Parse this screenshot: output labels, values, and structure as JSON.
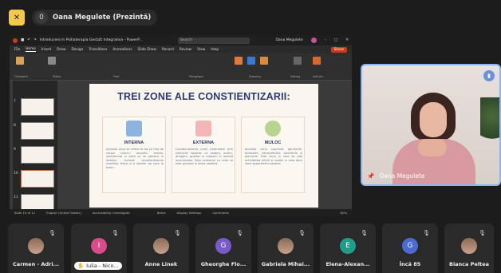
{
  "topbar": {
    "count": "0",
    "presenter_label": "Oana Megulete (Prezintă)",
    "accent": "#f2c94c"
  },
  "ppt": {
    "title_text": "Introducere în Psihoterapia Gestalt Integrativa - PowerP...",
    "search_placeholder": "Search",
    "user_name": "Oana Megulete",
    "menu": [
      "File",
      "Home",
      "Insert",
      "Draw",
      "Design",
      "Transitions",
      "Animations",
      "Slide Show",
      "Record",
      "Review",
      "View",
      "Help"
    ],
    "share_label": "Share",
    "ribbon_groups": [
      "Clipboard",
      "Slides",
      "Font",
      "Paragraph",
      "Drawing",
      "Editing",
      "Add-ins"
    ],
    "ribbon_buttons": [
      "Paste",
      "New Slide",
      "Shapes",
      "Arrange",
      "Quick Styles",
      "Editing",
      "Add-ins"
    ],
    "thumb_numbers": [
      "7",
      "8",
      "9",
      "10",
      "11"
    ],
    "status": [
      "Slide 10 of 11",
      "English (United States)",
      "Accessibility: Investigate",
      "Notes",
      "Display Settings",
      "Comments",
      "60%"
    ],
    "slide": {
      "title": "TREI ZONE ALE CONSTIENTIZARII:",
      "zones": [
        {
          "head": "INTERNA",
          "text": "Aceasta zona se refera la tot ce tine de corpul nostru: senzatii, emotii, sentimente si ceea ce se petrece in interior. Include constientizarea reactiilor fizice si a starilor pe care le traim.",
          "color": "#8fb3e0"
        },
        {
          "head": "EXTERNA",
          "text": "Constientizarea lumii exterioare prin simturile noastre: ce vedem, auzim, atingem, gustam si mirosim in mediul inconjurator. Este contactul cu ceea ce este prezent in afara noastra.",
          "color": "#f2b6b6"
        },
        {
          "head": "MIJLOC",
          "text": "Aceasta zona cuprinde gandurile, fanteziile, interpretarile, amintirile si planurile. Este locul in care se afla activitatea mintii si modul in care dam sens experientei noastre.",
          "color": "#b7d58f"
        }
      ]
    }
  },
  "speaker": {
    "name": "Oana Megulete"
  },
  "participants": [
    {
      "name": "Carmen - Adri...",
      "type": "photo"
    },
    {
      "name": "Iulia - Nico...",
      "type": "initial",
      "initial": "I",
      "color": "#d64d8a",
      "hand": true
    },
    {
      "name": "Anne Linek",
      "type": "photo"
    },
    {
      "name": "Gheorghe Flo...",
      "type": "initial",
      "initial": "G",
      "color": "#7a5ac8"
    },
    {
      "name": "Gabriela Mihai...",
      "type": "photo"
    },
    {
      "name": "Elena-Alexan...",
      "type": "initial",
      "initial": "E",
      "color": "#1f9c8a"
    },
    {
      "name": "Încă 85",
      "type": "more"
    },
    {
      "name": "Bianca Peltea",
      "type": "photo"
    }
  ]
}
